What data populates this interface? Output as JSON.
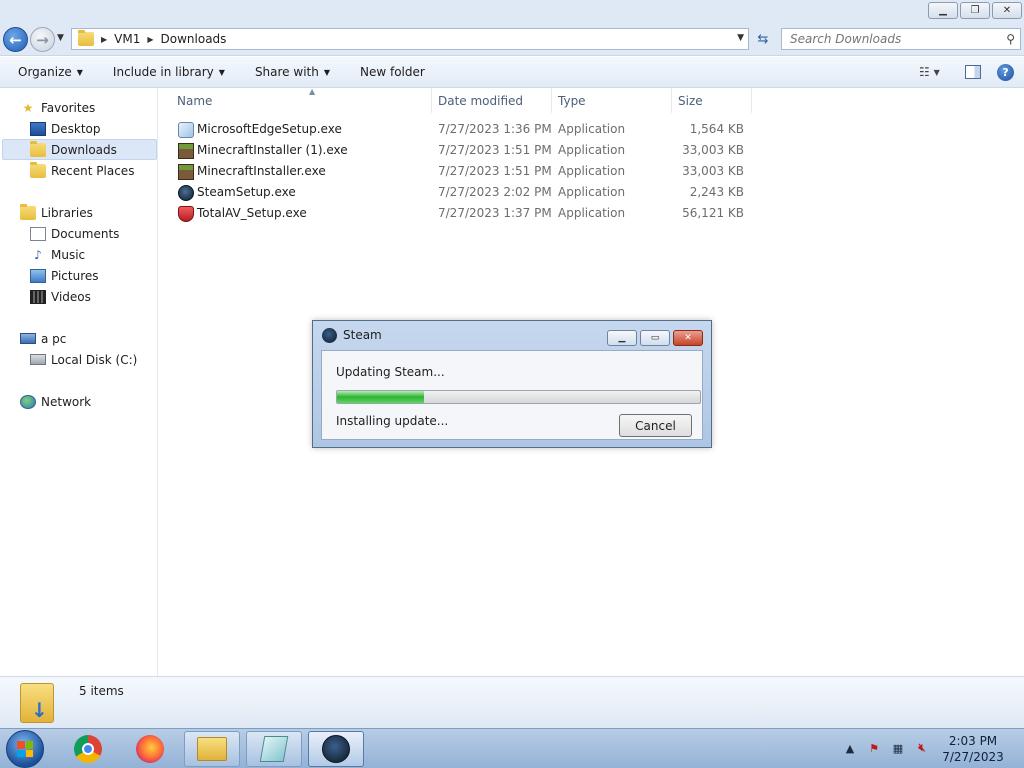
{
  "window": {
    "address": {
      "crumbs": [
        "VM1",
        "Downloads"
      ]
    },
    "search": {
      "placeholder": "Search Downloads"
    }
  },
  "toolbar": {
    "organize": "Organize",
    "include_in_library": "Include in library",
    "share_with": "Share with",
    "new_folder": "New folder"
  },
  "sidebar": {
    "favorites": "Favorites",
    "desktop": "Desktop",
    "downloads": "Downloads",
    "recent_places": "Recent Places",
    "libraries": "Libraries",
    "documents": "Documents",
    "music": "Music",
    "pictures": "Pictures",
    "videos": "Videos",
    "computer": "a pc",
    "local_disk": "Local Disk (C:)",
    "network": "Network"
  },
  "columns": {
    "name": "Name",
    "date_modified": "Date modified",
    "type": "Type",
    "size": "Size"
  },
  "files": [
    {
      "name": "MicrosoftEdgeSetup.exe",
      "date": "7/27/2023 1:36 PM",
      "type": "Application",
      "size": "1,564 KB",
      "icon": "edge-installer-icon"
    },
    {
      "name": "MinecraftInstaller (1).exe",
      "date": "7/27/2023 1:51 PM",
      "type": "Application",
      "size": "33,003 KB",
      "icon": "minecraft-icon"
    },
    {
      "name": "MinecraftInstaller.exe",
      "date": "7/27/2023 1:51 PM",
      "type": "Application",
      "size": "33,003 KB",
      "icon": "minecraft-icon"
    },
    {
      "name": "SteamSetup.exe",
      "date": "7/27/2023 2:02 PM",
      "type": "Application",
      "size": "2,243 KB",
      "icon": "steam-icon"
    },
    {
      "name": "TotalAV_Setup.exe",
      "date": "7/27/2023 1:37 PM",
      "type": "Application",
      "size": "56,121 KB",
      "icon": "totalav-icon"
    }
  ],
  "details": {
    "item_count": "5 items"
  },
  "steam_dialog": {
    "title": "Steam",
    "status": "Updating Steam...",
    "progress": 0.24,
    "substatus": "Installing update...",
    "cancel": "Cancel"
  },
  "taskbar": {
    "time": "2:03 PM",
    "date": "7/27/2023"
  }
}
